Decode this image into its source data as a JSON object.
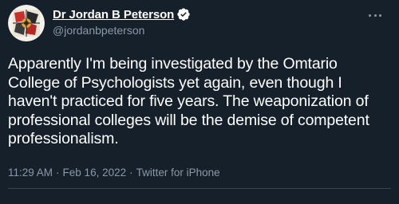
{
  "user": {
    "display_name": "Dr Jordan B Peterson",
    "handle": "@jordanbpeterson",
    "verified_icon": "verified-badge-icon",
    "avatar_icon": "profile-avatar"
  },
  "tweet": {
    "text": "Apparently I'm being investigated by the Omtario College of Psychologists yet again, even though I haven't practiced for five years. The weaponization of professional colleges will be the demise of competent professionalism.",
    "time": "11:29 AM",
    "date": "Feb 16, 2022",
    "source": "Twitter for iPhone",
    "separator": "·"
  },
  "menu": {
    "icon": "more-options-icon"
  },
  "colors": {
    "background": "#15202b",
    "text": "#ffffff",
    "muted": "#8b98a5",
    "verified": "#1d9bf0",
    "divider": "#38444d"
  }
}
